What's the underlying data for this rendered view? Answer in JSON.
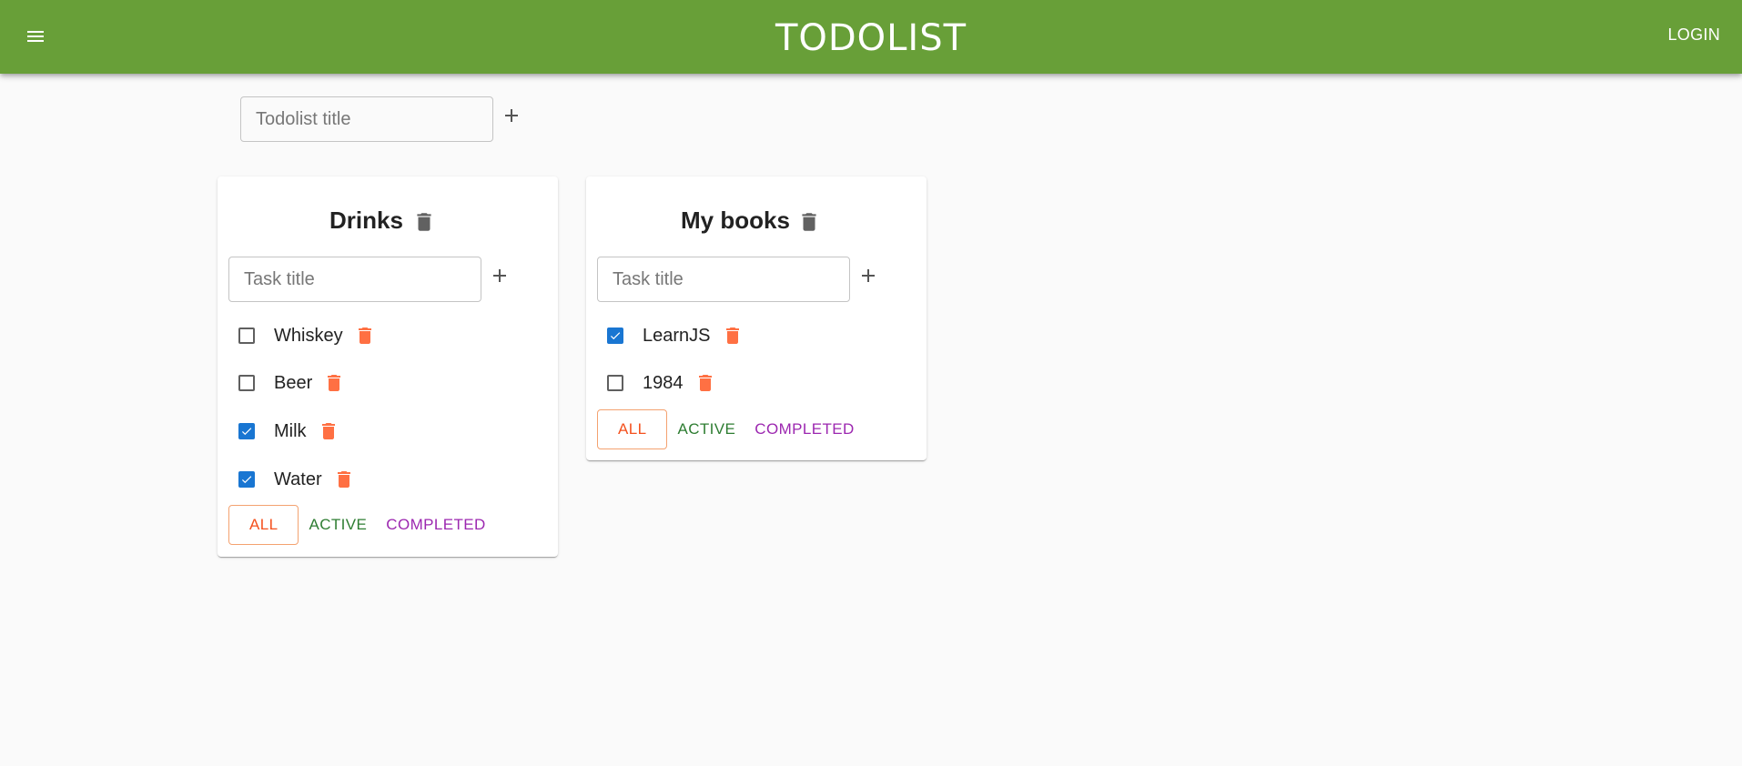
{
  "appbar": {
    "title": "TODOLIST",
    "login_label": "LOGIN",
    "background": "#689f38",
    "menu_icon": "menu-icon"
  },
  "add_todolist": {
    "placeholder": "Todolist title",
    "value": ""
  },
  "todolists": [
    {
      "title": "Drinks",
      "task_input": {
        "placeholder": "Task title",
        "value": ""
      },
      "tasks": [
        {
          "title": "Whiskey",
          "done": false
        },
        {
          "title": "Beer",
          "done": false
        },
        {
          "title": "Milk",
          "done": true
        },
        {
          "title": "Water",
          "done": true
        }
      ],
      "filters": {
        "all": "ALL",
        "active": "ACTIVE",
        "completed": "COMPLETED",
        "selected": "ALL"
      }
    },
    {
      "title": "My books",
      "task_input": {
        "placeholder": "Task title",
        "value": ""
      },
      "tasks": [
        {
          "title": "LearnJS",
          "done": true
        },
        {
          "title": "1984",
          "done": false
        }
      ],
      "filters": {
        "all": "ALL",
        "active": "ACTIVE",
        "completed": "COMPLETED",
        "selected": "ALL"
      }
    }
  ],
  "colors": {
    "accent_orange": "#f4511e",
    "trash_task": "#ff7043",
    "trash_list": "#616161",
    "checkbox_checked": "#1976d2",
    "filter_active": "#2e7d32",
    "filter_completed": "#9c27b0"
  }
}
